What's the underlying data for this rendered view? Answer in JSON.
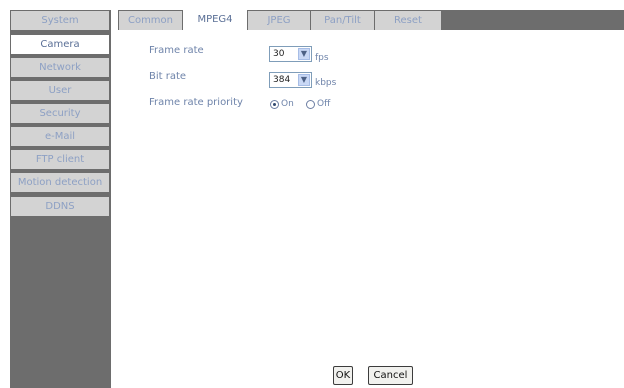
{
  "sidebar": {
    "items": [
      {
        "label": "System",
        "active": false
      },
      {
        "label": "Camera",
        "active": true
      },
      {
        "label": "Network",
        "active": false
      },
      {
        "label": "User",
        "active": false
      },
      {
        "label": "Security",
        "active": false
      },
      {
        "label": "e-Mail",
        "active": false
      },
      {
        "label": "FTP client",
        "active": false
      },
      {
        "label": "Motion detection",
        "active": false
      },
      {
        "label": "DDNS",
        "active": false
      }
    ]
  },
  "tabs": [
    {
      "label": "Common",
      "active": false
    },
    {
      "label": "MPEG4",
      "active": true
    },
    {
      "label": "JPEG",
      "active": false
    },
    {
      "label": "Pan/Tilt",
      "active": false
    },
    {
      "label": "Reset",
      "active": false
    }
  ],
  "form": {
    "frame_rate": {
      "label": "Frame rate",
      "value": "30",
      "unit": "fps"
    },
    "bit_rate": {
      "label": "Bit rate",
      "value": "384",
      "unit": "kbps"
    },
    "frame_rate_priority": {
      "label": "Frame rate priority",
      "options": [
        {
          "label": "On",
          "selected": true
        },
        {
          "label": "Off",
          "selected": false
        }
      ]
    }
  },
  "buttons": {
    "ok": "OK",
    "cancel": "Cancel"
  },
  "icons": {
    "dropdown": "chevron-down-icon"
  },
  "colors": {
    "frame": "#6d6d6d",
    "inactive_tab": "#d3d3d3",
    "text": "#6f84aa"
  }
}
